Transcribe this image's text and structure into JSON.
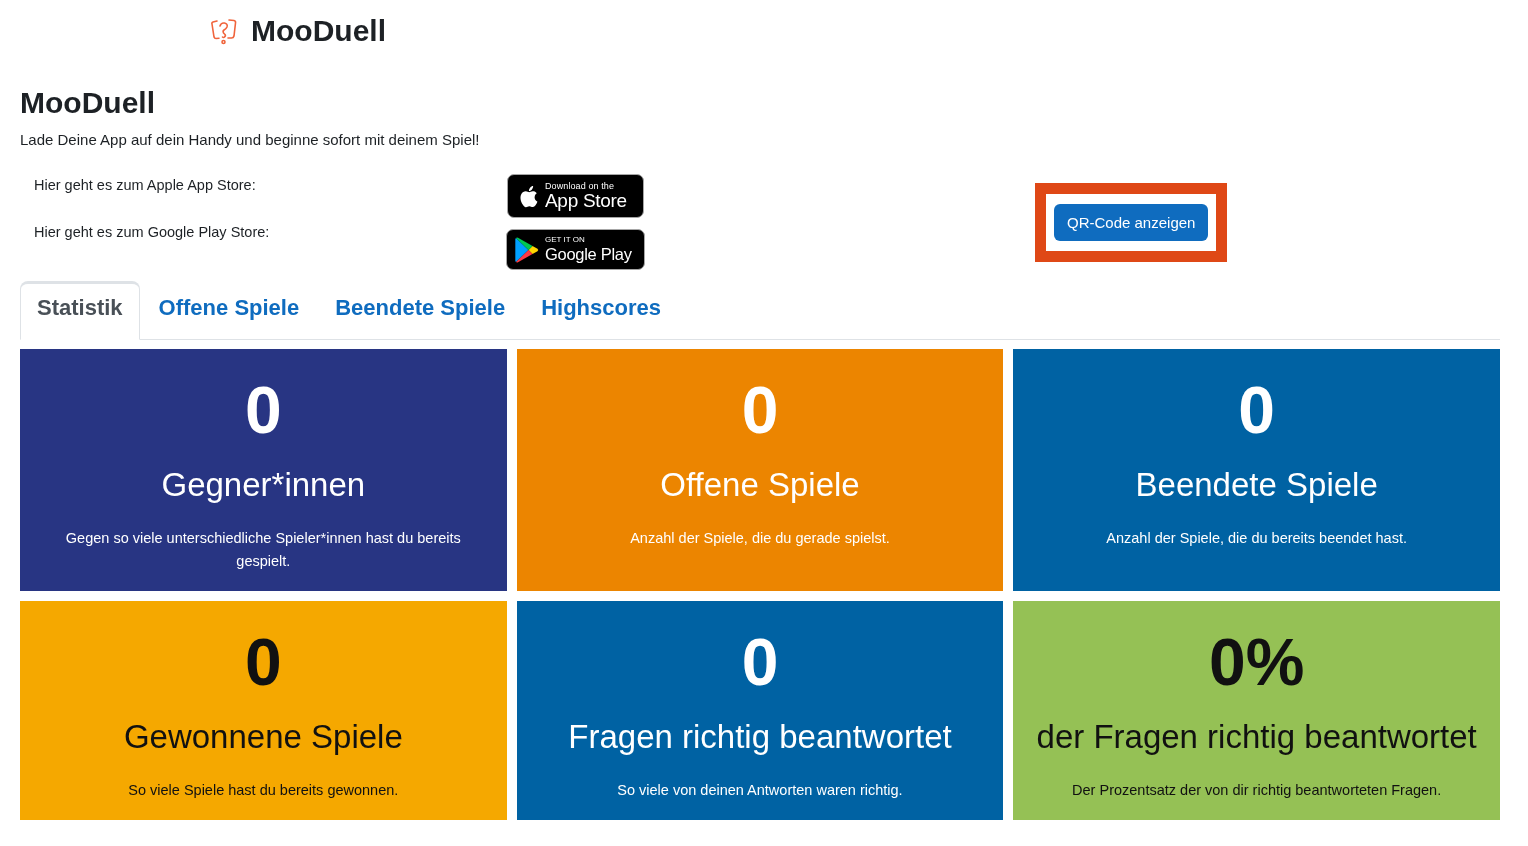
{
  "header": {
    "brand": "MooDuell"
  },
  "page": {
    "title": "MooDuell",
    "intro": "Lade Deine App auf dein Handy und beginne sofort mit deinem Spiel!"
  },
  "stores": [
    {
      "kind": "apple",
      "label": "Hier geht es zum Apple App Store:",
      "badge_top": "Download on the",
      "badge_main": "App Store"
    },
    {
      "kind": "google",
      "label": "Hier geht es zum Google Play Store:",
      "badge_top": "GET IT ON",
      "badge_main": "Google Play"
    }
  ],
  "qr_button": {
    "label": "QR-Code anzeigen",
    "highlighted": true
  },
  "tabs": [
    {
      "label": "Statistik",
      "selected": true
    },
    {
      "label": "Offene Spiele",
      "selected": false
    },
    {
      "label": "Beendete Spiele",
      "selected": false
    },
    {
      "label": "Highscores",
      "selected": false
    }
  ],
  "stats": [
    {
      "value": "0",
      "title": "Gegner*innen",
      "description": "Gegen so viele unterschiedliche Spieler*innen hast du bereits gespielt.",
      "color": "#283583"
    },
    {
      "value": "0",
      "title": "Offene Spiele",
      "description": "Anzahl der Spiele, die du gerade spielst.",
      "color": "#ec8500"
    },
    {
      "value": "0",
      "title": "Beendete Spiele",
      "description": "Anzahl der Spiele, die du bereits beendet hast.",
      "color": "#0062a3"
    },
    {
      "value": "0",
      "title": "Gewonnene Spiele",
      "description": "So viele Spiele hast du bereits gewonnen.",
      "color": "#f5a800"
    },
    {
      "value": "0",
      "title": "Fragen richtig beantwortet",
      "description": "So viele von deinen Antworten waren richtig.",
      "color": "#0062a3"
    },
    {
      "value": "0%",
      "title": "der Fragen richtig beantwortet",
      "description": "Der Prozentsatz der von dir richtig beantworteten Fragen.",
      "color": "#95c155"
    }
  ]
}
